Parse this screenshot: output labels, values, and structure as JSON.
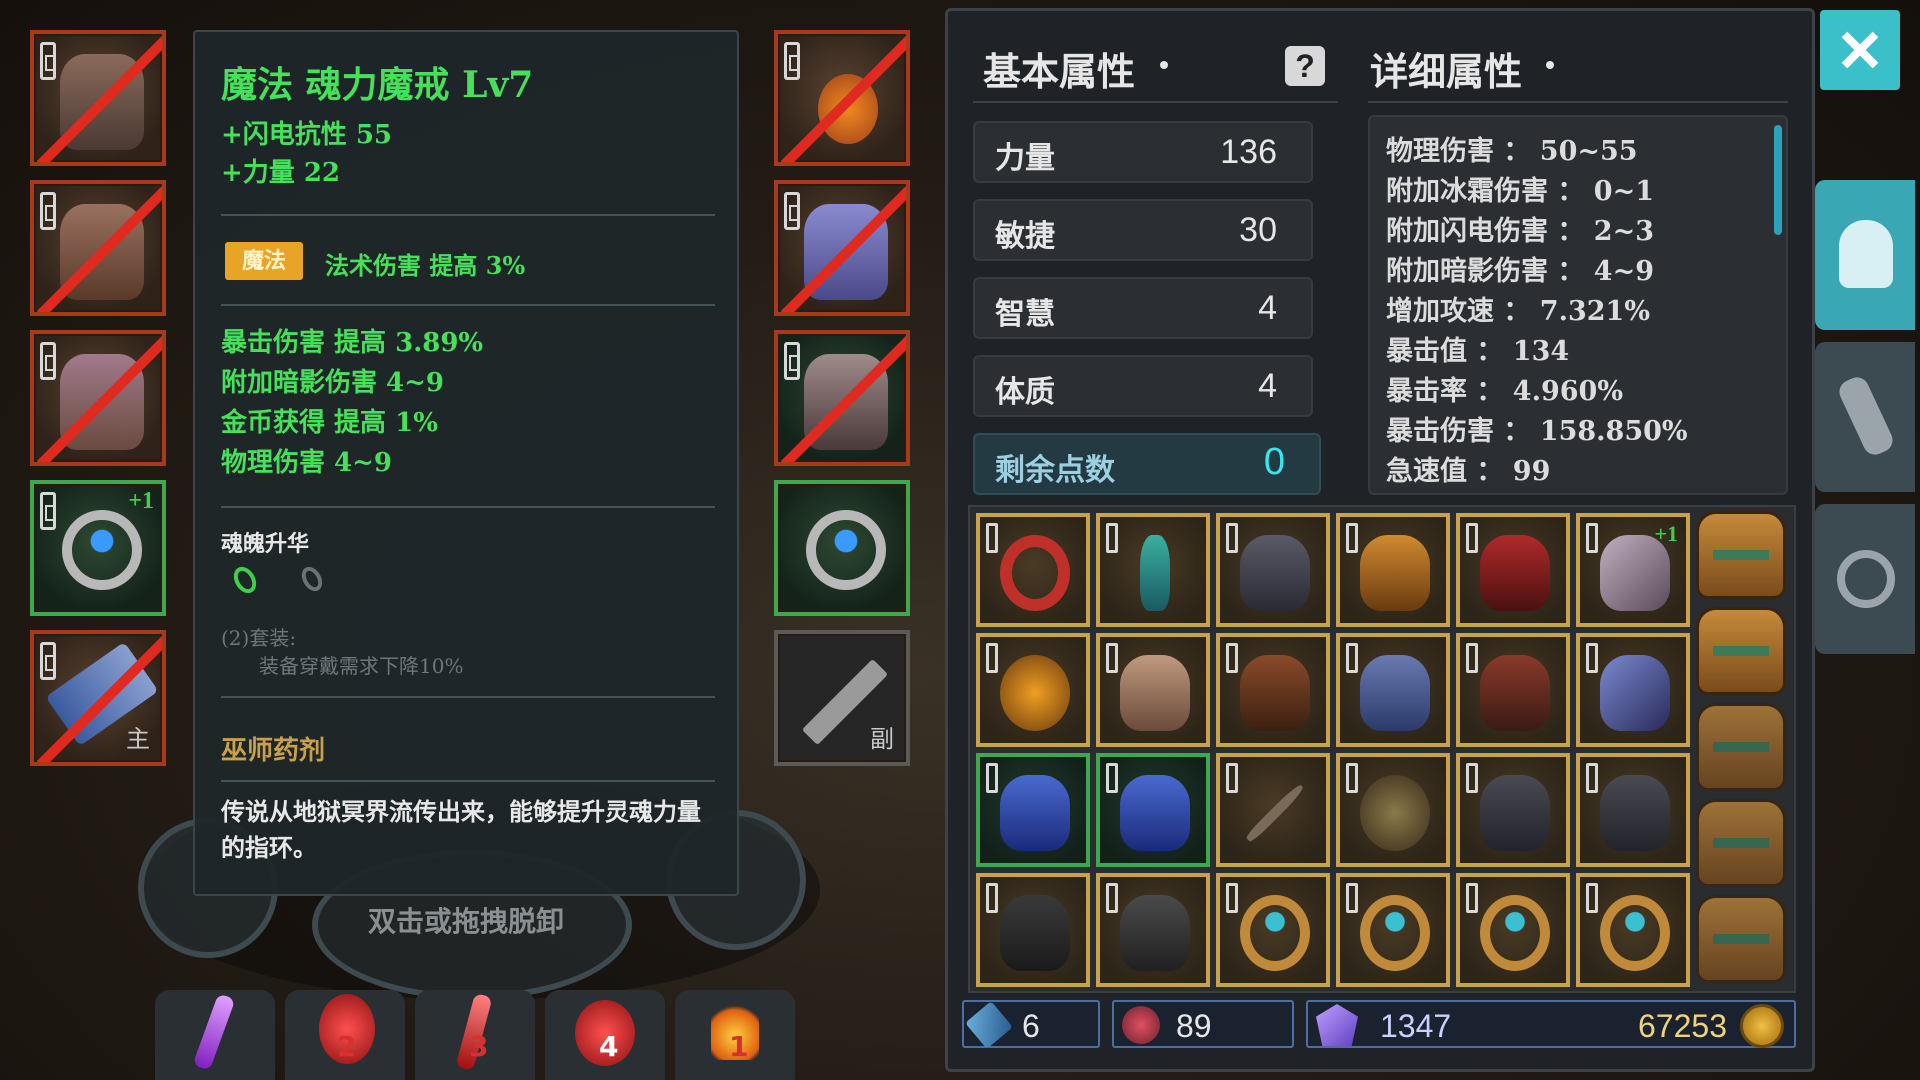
{
  "tooltip": {
    "title": "魔法  魂力魔戒  Lv7",
    "base_stats": [
      "+闪电抗性  55",
      "+力量  22"
    ],
    "badge": "魔法",
    "magic_effect": "法术伤害  提高  3%",
    "affixes": [
      "暴击伤害  提高  3.89%",
      "附加暗影伤害  4~9",
      "金币获得  提高  1%",
      "物理伤害  4~9"
    ],
    "soul_title": "魂魄升华",
    "set_label": "(2)套装:",
    "set_effect": "装备穿戴需求下降10%",
    "set_name": "巫师药剂",
    "flavor": "传说从地狱冥界流传出来，能够提升灵魂力量的指环。"
  },
  "equip": {
    "ring_plus": "+1",
    "main_mark": "主",
    "sub_mark": "副"
  },
  "hint": "双击或拖拽脱卸",
  "panel": {
    "basic_title": "基本属性",
    "detail_title": "详细属性",
    "stats": [
      {
        "label": "力量",
        "value": "136"
      },
      {
        "label": "敏捷",
        "value": "30"
      },
      {
        "label": "智慧",
        "value": "4"
      },
      {
        "label": "体质",
        "value": "4"
      }
    ],
    "remaining": {
      "label": "剩余点数",
      "value": "0"
    },
    "details": [
      "物理伤害 ： 50~55",
      "附加冰霜伤害 ： 0~1",
      "附加闪电伤害 ： 2~3",
      "附加暗影伤害 ： 4~9",
      "增加攻速 ： 7.321%",
      "暴击值 ： 134",
      "暴击率 ： 4.960%",
      "暴击伤害 ： 158.850%",
      "急速值 ： 99"
    ],
    "inv_plus": "+1"
  },
  "currency": {
    "keys": "6",
    "gems": "89",
    "crystals": "1347",
    "gold": "67253"
  },
  "potions": [
    "2",
    "3",
    "4",
    "1"
  ],
  "colors": {
    "accent": "#3aa8b4",
    "green_text": "#47e05a",
    "slot_red": "#a83a1c",
    "slot_green": "#3ea84e",
    "gold_border": "#c9a24a"
  }
}
